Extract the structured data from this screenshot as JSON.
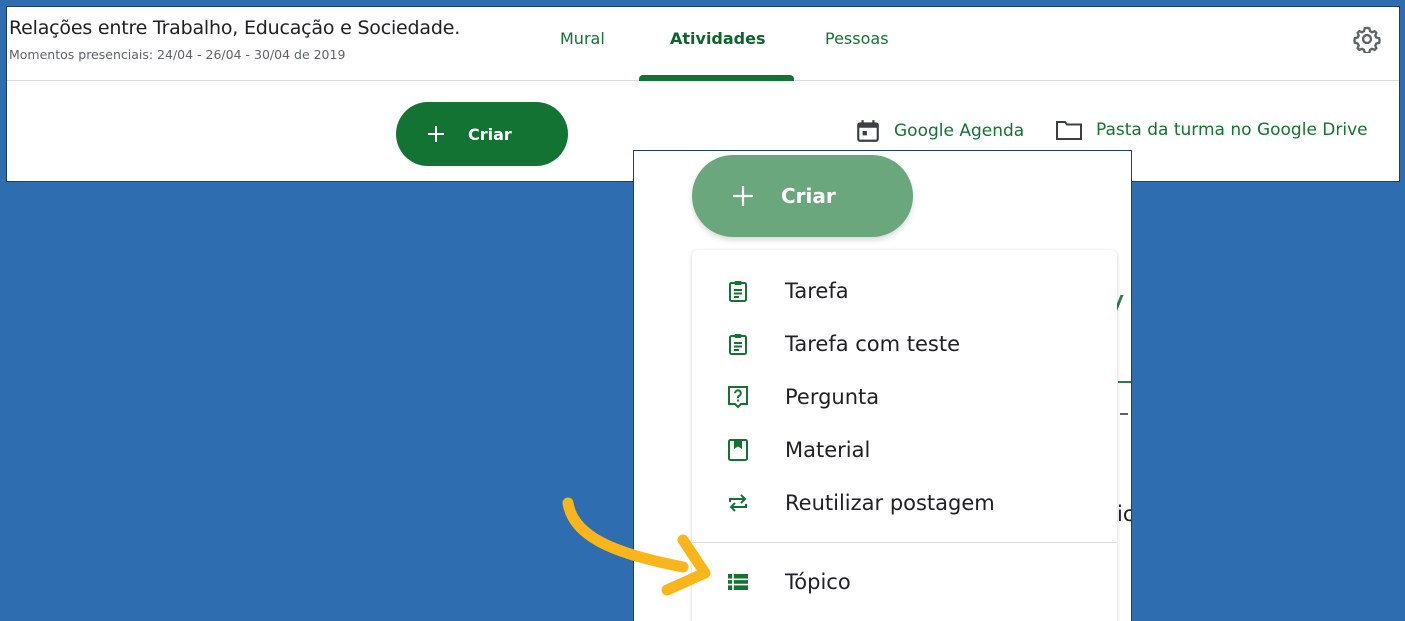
{
  "header": {
    "title": "Relações entre Trabalho, Educação e Sociedade.",
    "subtitle": "Momentos presenciais: 24/04 - 26/04 - 30/04 de 2019",
    "tabs": [
      {
        "label": "Mural",
        "active": false
      },
      {
        "label": "Atividades",
        "active": true
      },
      {
        "label": "Pessoas",
        "active": false
      }
    ],
    "settings_icon": "gear-icon"
  },
  "toolbar": {
    "create_label": "Criar",
    "calendar_label": "Google Agenda",
    "drive_label": "Pasta da turma no Google Drive"
  },
  "menu": {
    "create_label": "Criar",
    "items": [
      {
        "label": "Tarefa",
        "icon": "assignment-icon"
      },
      {
        "label": "Tarefa com teste",
        "icon": "quiz-assignment-icon"
      },
      {
        "label": "Pergunta",
        "icon": "question-icon"
      },
      {
        "label": "Material",
        "icon": "material-icon"
      },
      {
        "label": "Reutilizar postagem",
        "icon": "reuse-icon"
      },
      {
        "label": "Tópico",
        "icon": "topic-icon"
      }
    ],
    "background_fragment": "ic"
  },
  "colors": {
    "background": "#2e6db0",
    "primary_green": "#137333",
    "faded_green": "#6aa77d",
    "arrow": "#f9b51a"
  }
}
